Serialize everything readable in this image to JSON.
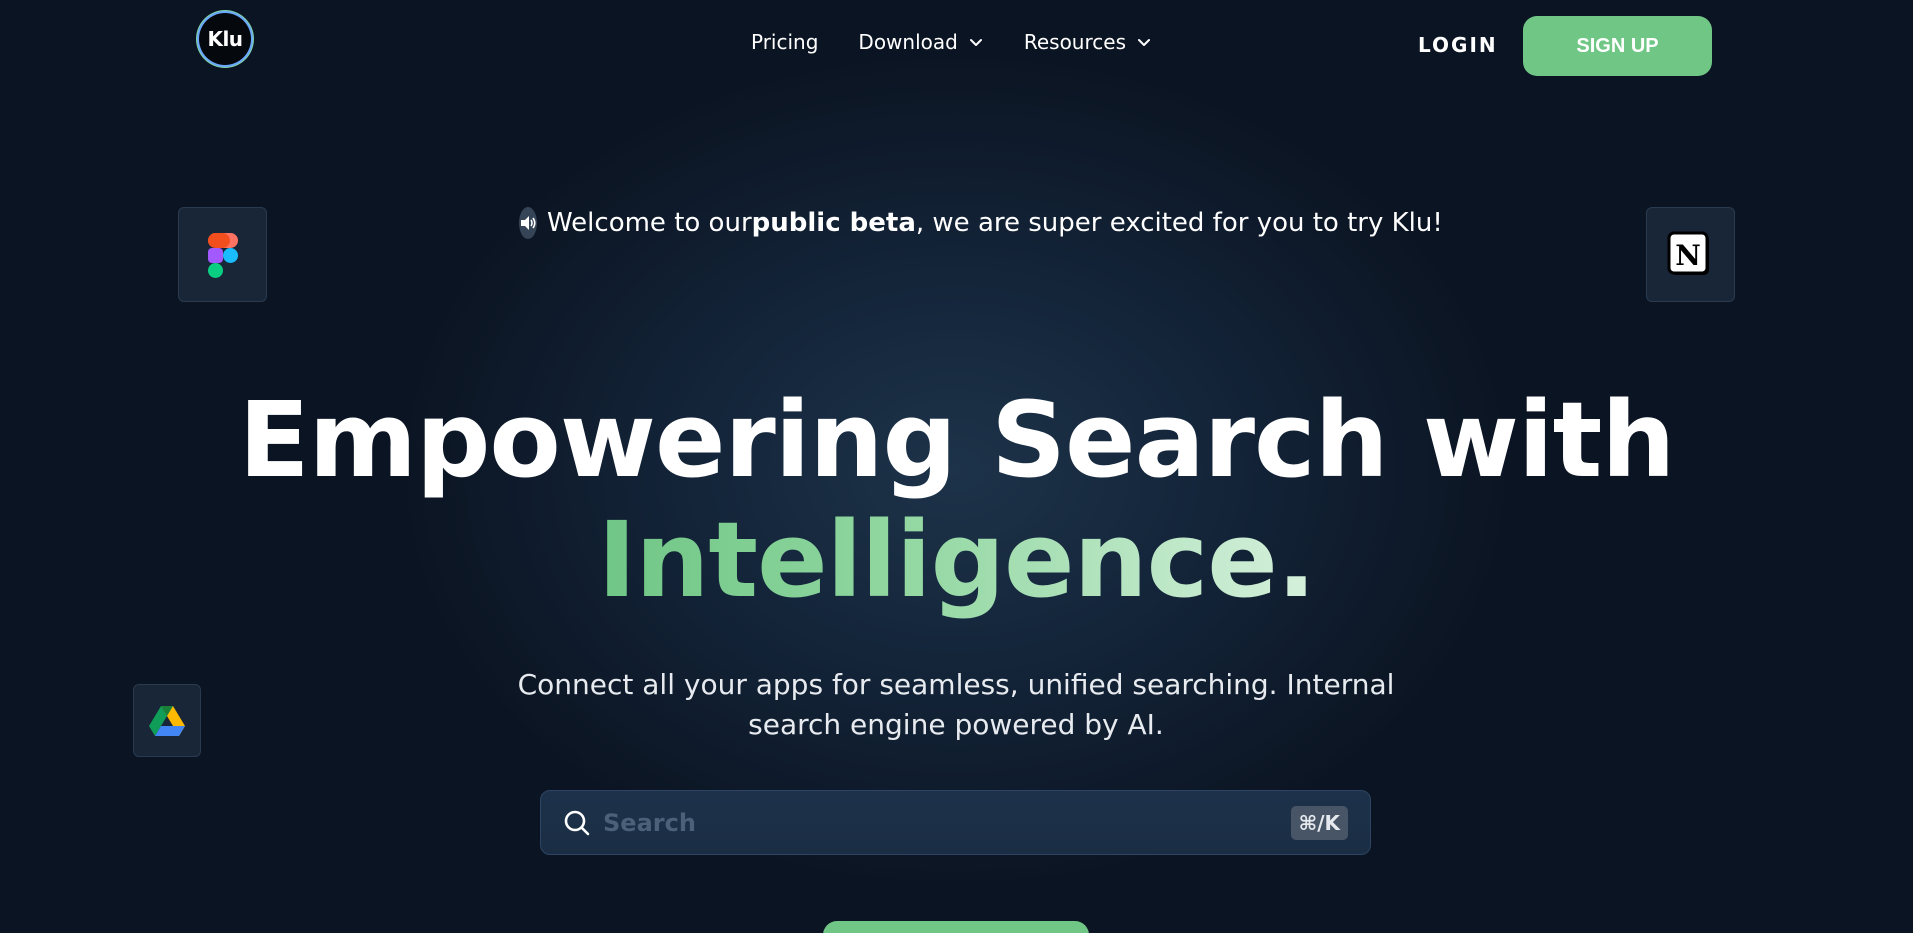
{
  "nav": {
    "logo_text": "Klu",
    "links": [
      {
        "label": "Pricing",
        "has_dropdown": false
      },
      {
        "label": "Download",
        "has_dropdown": true
      },
      {
        "label": "Resources",
        "has_dropdown": true
      }
    ],
    "login_label": "LOGIN",
    "signup_label": "SIGN UP"
  },
  "announcement": {
    "prefix": "Welcome to our ",
    "bold": "public beta",
    "suffix": ", we are super excited for you to try Klu!"
  },
  "hero": {
    "line1": "Empowering Search with",
    "line2": "Intelligence.",
    "subtitle_line1": "Connect all your apps for seamless, unified searching. Internal",
    "subtitle_line2": "search engine powered by AI."
  },
  "search": {
    "placeholder": "Search",
    "shortcut": "⌘/K"
  },
  "apps": [
    "figma-icon",
    "notion-icon",
    "google-drive-icon"
  ],
  "colors": {
    "accent": "#6fc685",
    "background": "#0b1422"
  }
}
